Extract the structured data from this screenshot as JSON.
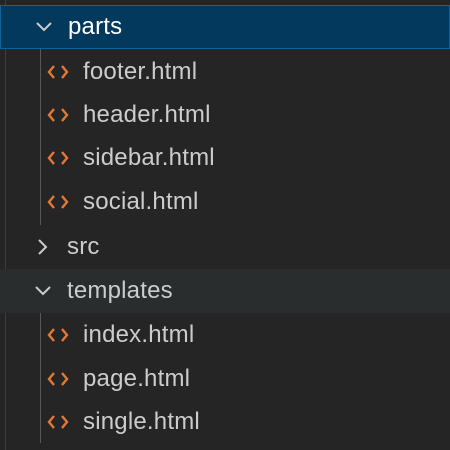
{
  "explorer": {
    "folders": {
      "parts": {
        "label": "parts",
        "expanded": true,
        "selected": true
      },
      "src": {
        "label": "src",
        "expanded": false
      },
      "templates": {
        "label": "templates",
        "expanded": true
      }
    },
    "parts_files": [
      {
        "label": "footer.html",
        "icon": "html-code-icon"
      },
      {
        "label": "header.html",
        "icon": "html-code-icon"
      },
      {
        "label": "sidebar.html",
        "icon": "html-code-icon"
      },
      {
        "label": "social.html",
        "icon": "html-code-icon"
      }
    ],
    "templates_files": [
      {
        "label": "index.html",
        "icon": "html-code-icon"
      },
      {
        "label": "page.html",
        "icon": "html-code-icon"
      },
      {
        "label": "single.html",
        "icon": "html-code-icon"
      }
    ]
  },
  "colors": {
    "background": "#252526",
    "selection": "#04395e",
    "selection_border": "#0e639c",
    "html_icon": "#e37933",
    "text": "#cccccc"
  }
}
